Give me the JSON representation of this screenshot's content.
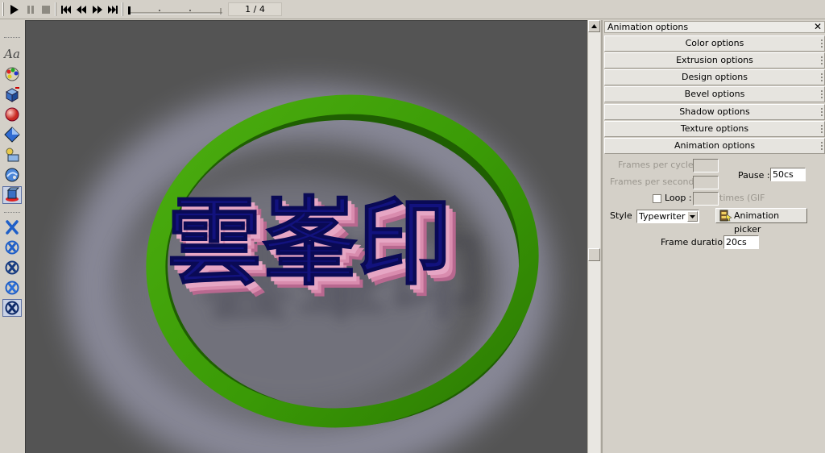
{
  "toolbar": {
    "play": "play-icon",
    "pause": "pause-icon",
    "stop": "stop-icon",
    "first": "skip-first-icon",
    "prev": "step-back-icon",
    "next": "step-forward-icon",
    "last": "skip-last-icon",
    "frame_counter": "1 / 4",
    "current_frame": 1,
    "total_frames": 4
  },
  "tools": [
    {
      "name": "text",
      "label": "Aa"
    },
    {
      "name": "color-palette"
    },
    {
      "name": "extrude-cube"
    },
    {
      "name": "sphere-material"
    },
    {
      "name": "diamond-shape"
    },
    {
      "name": "shapes-layers"
    },
    {
      "name": "globe-texture"
    },
    {
      "name": "3d-object",
      "active": true
    },
    {
      "name": "transform-x"
    },
    {
      "name": "rotate-x"
    },
    {
      "name": "rotate-x-alt"
    },
    {
      "name": "rotate-x-3"
    },
    {
      "name": "rotate-x-4",
      "active": true
    }
  ],
  "canvas": {
    "text": "雲峯印",
    "colors": {
      "background": "#545454",
      "ring": "#3a9a06",
      "text_face": "#12127e",
      "text_extrusion": "#d98cae",
      "glow": "#9a9aae"
    }
  },
  "panel": {
    "title": "Animation options",
    "sections": [
      "Color options",
      "Extrusion options",
      "Design options",
      "Bevel options",
      "Shadow options",
      "Texture options",
      "Animation options"
    ],
    "animation": {
      "frames_per_cycle_label": "Frames per cycle",
      "frames_per_cycle_value": "",
      "frames_per_second_label": "Frames per second",
      "frames_per_second_value": "",
      "pause_label": "Pause :",
      "pause_value": "50cs",
      "loop_label": "Loop :",
      "loop_checked": false,
      "loop_value": "",
      "loop_suffix": "times (GIF",
      "style_label": "Style",
      "style_value": "Typewriter",
      "picker_label": "Animation picker",
      "frame_duration_label": "Frame duration",
      "frame_duration_value": "20cs"
    }
  }
}
